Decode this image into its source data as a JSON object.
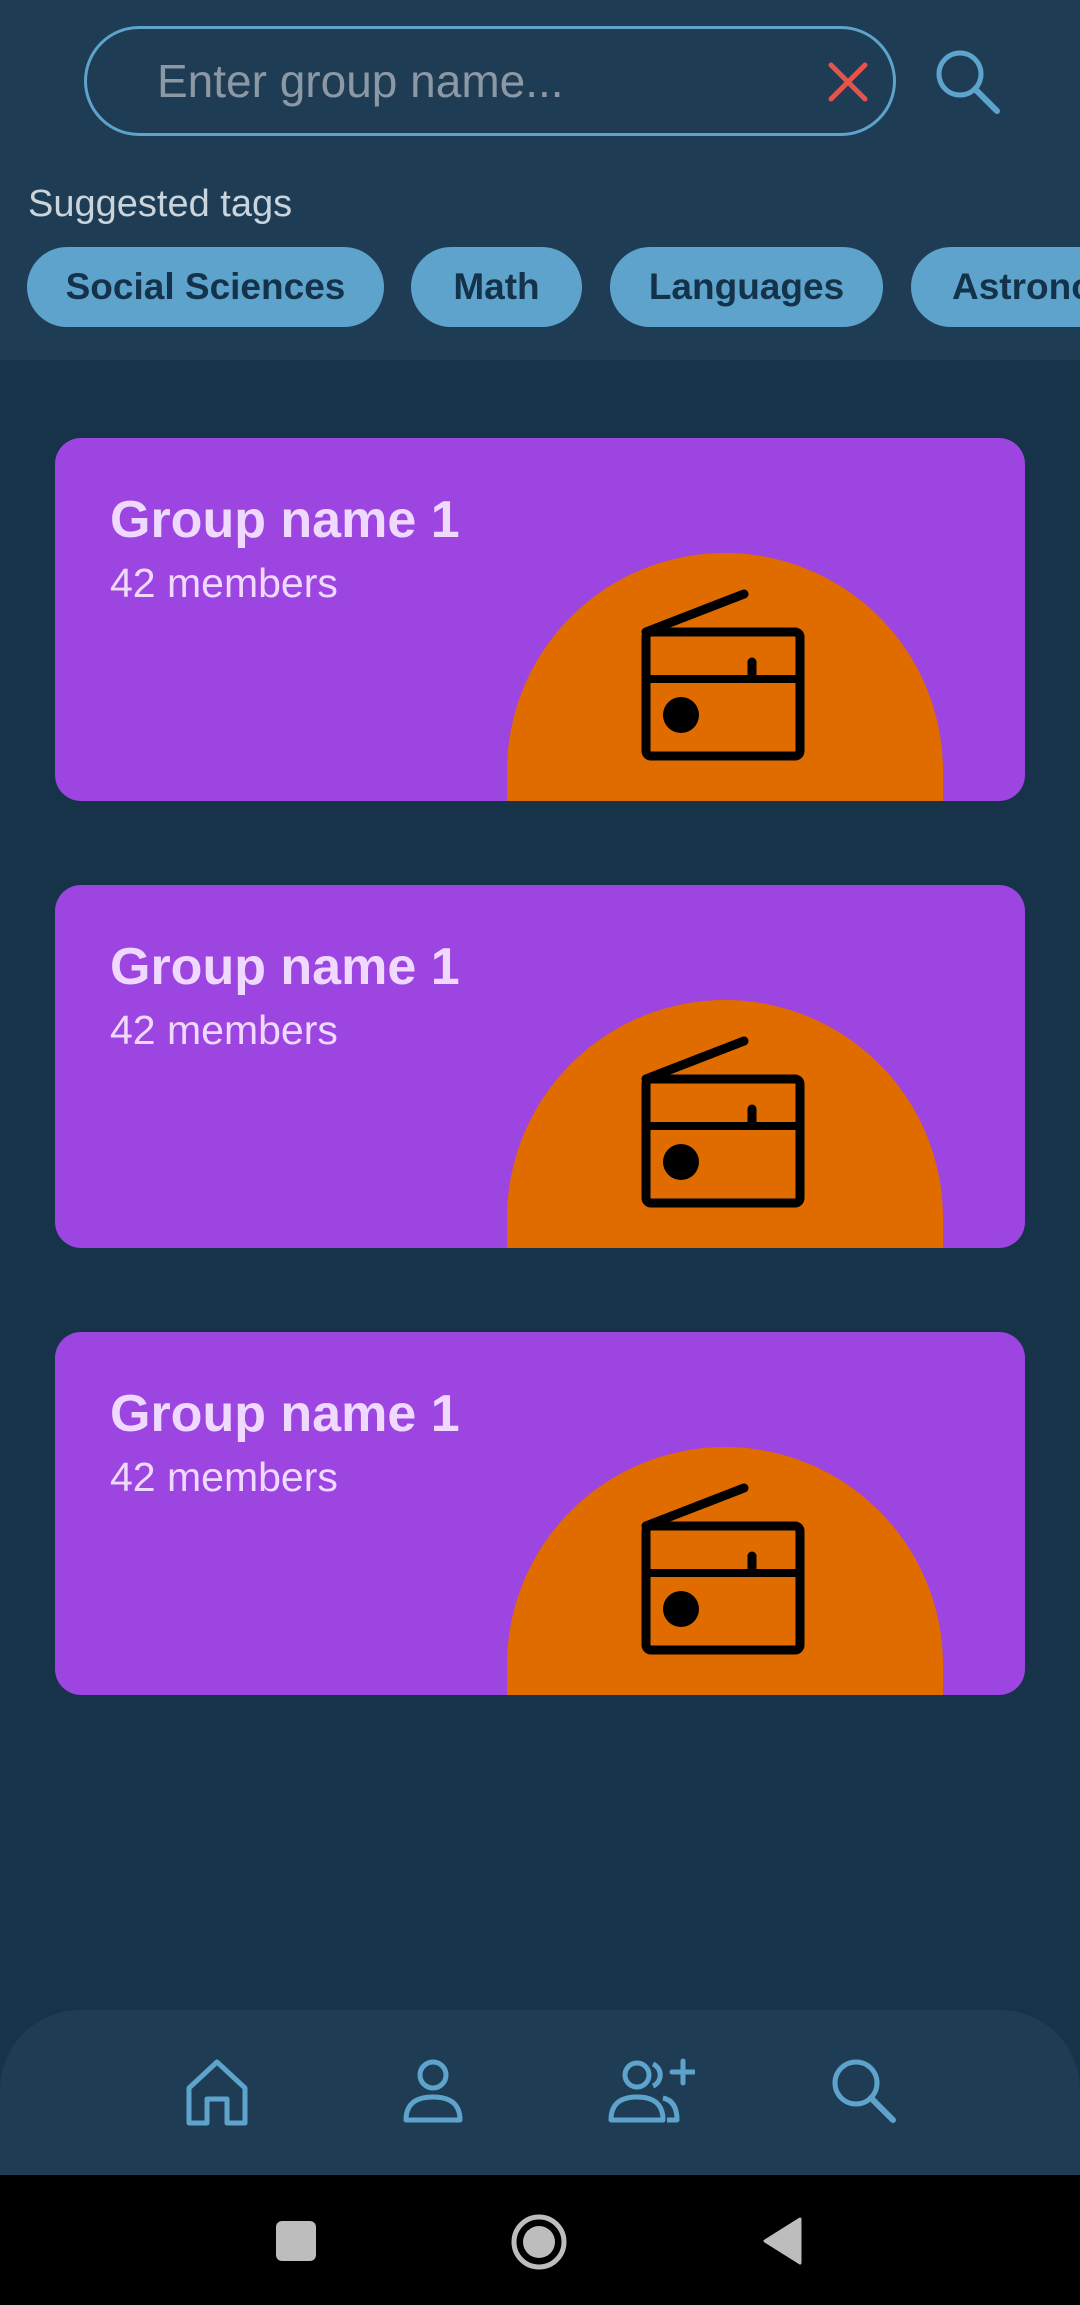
{
  "search": {
    "placeholder": "Enter group name...",
    "value": ""
  },
  "tags": {
    "title": "Suggested tags",
    "items": [
      "Social Sciences",
      "Math",
      "Languages",
      "Astronomy"
    ]
  },
  "groups": [
    {
      "name": "Group name 1",
      "members": "42 members",
      "icon": "radio-icon"
    },
    {
      "name": "Group name 1",
      "members": "42 members",
      "icon": "radio-icon"
    },
    {
      "name": "Group name 1",
      "members": "42 members",
      "icon": "radio-icon"
    }
  ],
  "nav": {
    "items": [
      "home-icon",
      "profile-icon",
      "add-friend-icon",
      "search-icon"
    ],
    "active": "search-icon"
  },
  "colors": {
    "background": "#16334a",
    "panel": "#1e3d55",
    "accent": "#5ea3cb",
    "card": "#9c45e1",
    "badge": "#e06c00",
    "clear": "#e5534b",
    "card_text": "#f0d9ff"
  }
}
